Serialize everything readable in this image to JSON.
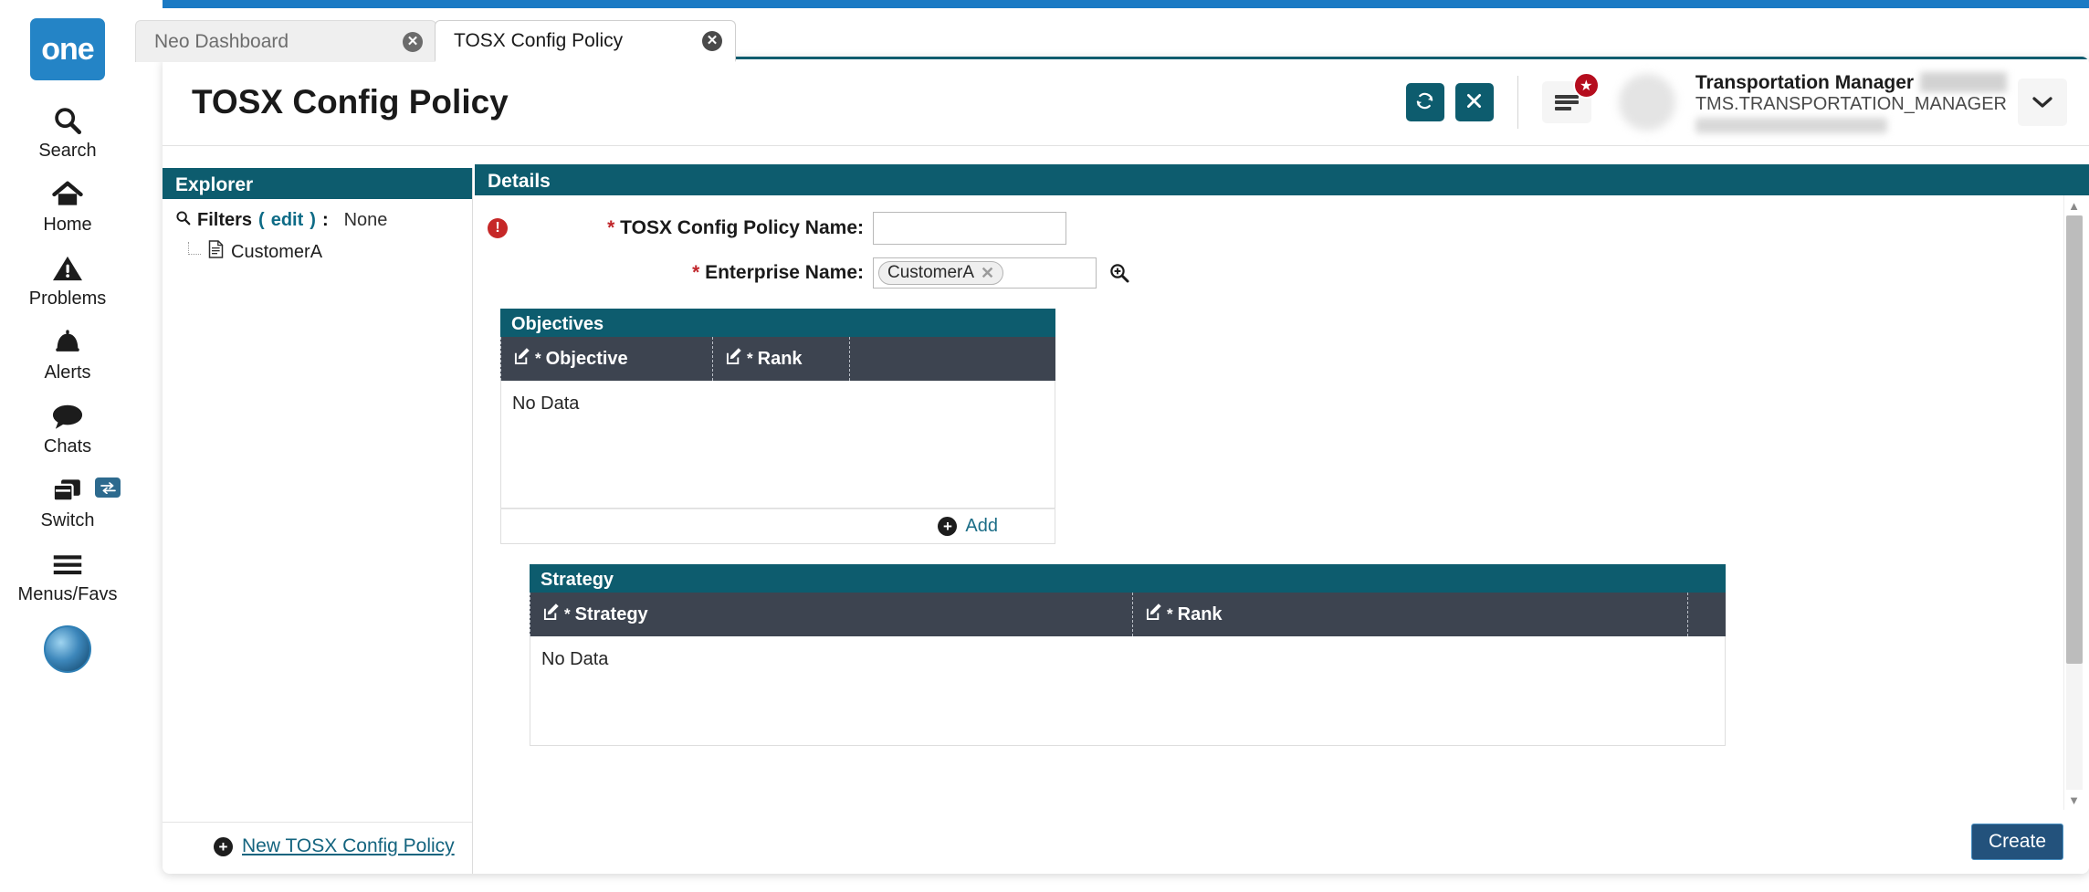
{
  "rail": {
    "logo_text": "one",
    "items": [
      {
        "label": "Search",
        "icon": "search-icon"
      },
      {
        "label": "Home",
        "icon": "home-icon"
      },
      {
        "label": "Problems",
        "icon": "warning-triangle-icon"
      },
      {
        "label": "Alerts",
        "icon": "bell-icon"
      },
      {
        "label": "Chats",
        "icon": "chat-bubble-icon"
      },
      {
        "label": "Switch",
        "icon": "windows-stack-icon"
      },
      {
        "label": "Menus/Favs",
        "icon": "hamburger-icon"
      }
    ],
    "switch_badge_icon": "swap-arrows-icon"
  },
  "tabs": [
    {
      "label": "Neo Dashboard",
      "active": false,
      "close_icon": "close-circle-icon"
    },
    {
      "label": "TOSX Config Policy",
      "active": true,
      "close_icon": "close-circle-icon"
    }
  ],
  "header": {
    "title": "TOSX Config Policy",
    "refresh_icon": "refresh-icon",
    "close_icon": "close-x-icon",
    "menu_icon": "hamburger-menu-icon",
    "star_badge_icon": "star-icon",
    "caret_icon": "chevron-down-icon",
    "user_name": "Transportation Manager",
    "user_role": "TMS.TRANSPORTATION_MANAGER"
  },
  "explorer": {
    "title": "Explorer",
    "filter_icon": "search-icon",
    "filters_label": "Filters",
    "filters_edit": "edit",
    "filters_paren_open": "(",
    "filters_paren_close": ")",
    "filters_colon": ":",
    "filters_value": "None",
    "tree_item_icon": "document-icon",
    "tree_item_label": "CustomerA",
    "new_link_label": "New TOSX Config Policy",
    "new_link_icon": "plus-circle-icon"
  },
  "details": {
    "title": "Details",
    "error_icon": "error-exclamation-icon",
    "fields": {
      "policy_name": {
        "required_mark": "*",
        "label": "TOSX Config Policy Name:",
        "value": "",
        "placeholder": ""
      },
      "enterprise_name": {
        "required_mark": "*",
        "label": "Enterprise Name:",
        "chip_value": "CustomerA",
        "chip_remove_icon": "close-x-icon",
        "search_icon": "magnifier-plus-icon"
      }
    },
    "objectives_grid": {
      "title": "Objectives",
      "columns": [
        {
          "label": "Objective",
          "edit_icon": "edit-pencil-icon",
          "required_mark": "*"
        },
        {
          "label": "Rank",
          "edit_icon": "edit-pencil-icon",
          "required_mark": "*"
        }
      ],
      "empty_text": "No Data",
      "add_label": "Add",
      "add_icon": "plus-circle-icon"
    },
    "strategy_grid": {
      "title": "Strategy",
      "columns": [
        {
          "label": "Strategy",
          "edit_icon": "edit-pencil-icon",
          "required_mark": "*"
        },
        {
          "label": "Rank",
          "edit_icon": "edit-pencil-icon",
          "required_mark": "*"
        }
      ],
      "empty_text": "No Data"
    },
    "scrollbar": {
      "up_icon": "triangle-up-icon",
      "down_icon": "triangle-down-icon"
    },
    "create_button": "Create"
  },
  "colors": {
    "teal_panel": "#0d5c6e",
    "grid_header": "#3d4450",
    "top_strip_blue": "#1b7ac4",
    "logo_blue": "#2484c6",
    "create_blue": "#23527c",
    "link_teal": "#14647f",
    "error_red": "#c62828",
    "badge_red": "#b50d1e",
    "required_red": "#c0262b"
  }
}
